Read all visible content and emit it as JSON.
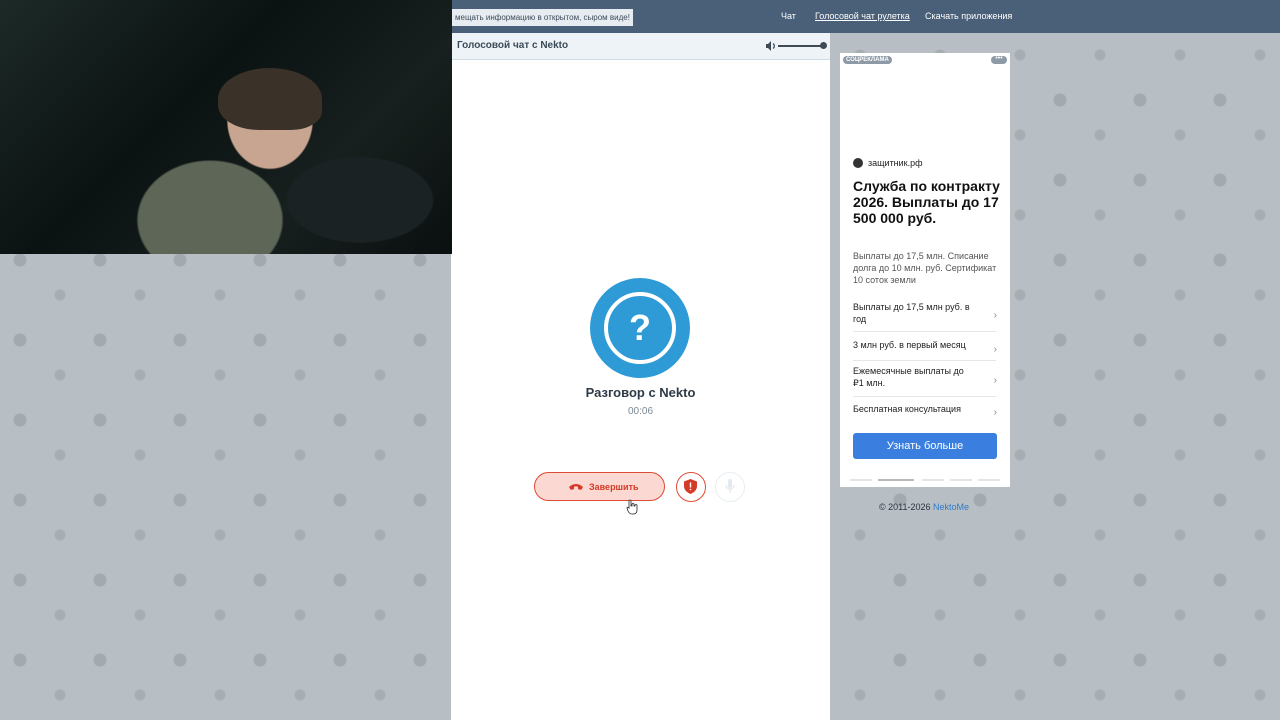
{
  "topbar": {
    "notice": "мещать информацию в открытом, сыром виде!",
    "nav": [
      "Чат",
      "Голосовой чат рулетка",
      "Скачать приложения"
    ]
  },
  "chat": {
    "title": "Голосовой чат с Nekto",
    "volume_level": 1.0,
    "avatar_symbol": "?",
    "caller_name": "Разговор с Nekto",
    "timer": "00:06",
    "end_button": "Завершить"
  },
  "ad": {
    "label": "СОЦРЕКЛАМА",
    "more": "•••",
    "domain": "защитник.рф",
    "headline": "Служба по контракту 2026. Выплаты до 17 500 000 руб.",
    "description": "Выплаты до 17,5 млн. Списание долга до 10 млн. руб. Сертификат 10 соток земли",
    "rows": [
      "Выплаты до 17,5 млн руб. в год",
      "3 млн руб. в первый месяц",
      "Ежемесячные выплаты до ₽1 млн.",
      "Бесплатная консультация"
    ],
    "cta": "Узнать больше"
  },
  "footer": {
    "copyright": "© 2011-2026",
    "link": "NektoMe"
  },
  "colors": {
    "topbar": "#4a5f78",
    "avatar": "#2f9bd6",
    "end_call": "#e04a35",
    "cta": "#3a7fe0"
  }
}
